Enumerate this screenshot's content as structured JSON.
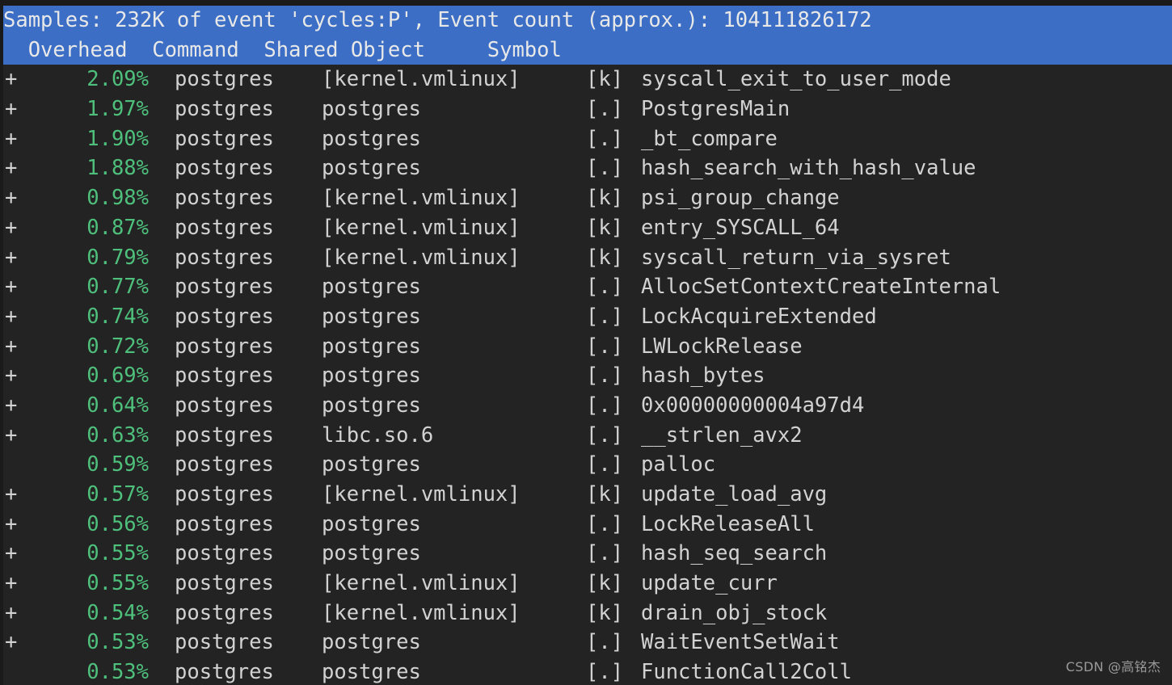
{
  "app": {
    "name": "perf report",
    "colors": {
      "header_bg": "#3b6ec4",
      "header_fg": "#e8e8e8",
      "background": "#232323",
      "overhead_green": "#4ec07c",
      "text_gray": "#d2d2d2"
    }
  },
  "header": {
    "summary": "Samples: 232K of event 'cycles:P', Event count (approx.): 104111826172",
    "samples": "232K",
    "event": "cycles:P",
    "event_count": "104111826172",
    "columns_line": "  Overhead  Command  Shared Object     Symbol",
    "columns": {
      "overhead": "Overhead",
      "command": "Command",
      "shared_object": "Shared Object",
      "symbol": "Symbol"
    }
  },
  "rows": [
    {
      "marker": "+",
      "overhead": "2.09%",
      "command": "postgres",
      "dso": "[kernel.vmlinux]",
      "level": "[k]",
      "symbol": "syscall_exit_to_user_mode"
    },
    {
      "marker": "+",
      "overhead": "1.97%",
      "command": "postgres",
      "dso": "postgres",
      "level": "[.]",
      "symbol": "PostgresMain"
    },
    {
      "marker": "+",
      "overhead": "1.90%",
      "command": "postgres",
      "dso": "postgres",
      "level": "[.]",
      "symbol": "_bt_compare"
    },
    {
      "marker": "+",
      "overhead": "1.88%",
      "command": "postgres",
      "dso": "postgres",
      "level": "[.]",
      "symbol": "hash_search_with_hash_value"
    },
    {
      "marker": "+",
      "overhead": "0.98%",
      "command": "postgres",
      "dso": "[kernel.vmlinux]",
      "level": "[k]",
      "symbol": "psi_group_change"
    },
    {
      "marker": "+",
      "overhead": "0.87%",
      "command": "postgres",
      "dso": "[kernel.vmlinux]",
      "level": "[k]",
      "symbol": "entry_SYSCALL_64"
    },
    {
      "marker": "+",
      "overhead": "0.79%",
      "command": "postgres",
      "dso": "[kernel.vmlinux]",
      "level": "[k]",
      "symbol": "syscall_return_via_sysret"
    },
    {
      "marker": "+",
      "overhead": "0.77%",
      "command": "postgres",
      "dso": "postgres",
      "level": "[.]",
      "symbol": "AllocSetContextCreateInternal"
    },
    {
      "marker": "+",
      "overhead": "0.74%",
      "command": "postgres",
      "dso": "postgres",
      "level": "[.]",
      "symbol": "LockAcquireExtended"
    },
    {
      "marker": "+",
      "overhead": "0.72%",
      "command": "postgres",
      "dso": "postgres",
      "level": "[.]",
      "symbol": "LWLockRelease"
    },
    {
      "marker": "+",
      "overhead": "0.69%",
      "command": "postgres",
      "dso": "postgres",
      "level": "[.]",
      "symbol": "hash_bytes"
    },
    {
      "marker": "+",
      "overhead": "0.64%",
      "command": "postgres",
      "dso": "postgres",
      "level": "[.]",
      "symbol": "0x00000000004a97d4"
    },
    {
      "marker": "+",
      "overhead": "0.63%",
      "command": "postgres",
      "dso": "libc.so.6",
      "level": "[.]",
      "symbol": "__strlen_avx2"
    },
    {
      "marker": "",
      "overhead": "0.59%",
      "command": "postgres",
      "dso": "postgres",
      "level": "[.]",
      "symbol": "palloc"
    },
    {
      "marker": "+",
      "overhead": "0.57%",
      "command": "postgres",
      "dso": "[kernel.vmlinux]",
      "level": "[k]",
      "symbol": "update_load_avg"
    },
    {
      "marker": "+",
      "overhead": "0.56%",
      "command": "postgres",
      "dso": "postgres",
      "level": "[.]",
      "symbol": "LockReleaseAll"
    },
    {
      "marker": "+",
      "overhead": "0.55%",
      "command": "postgres",
      "dso": "postgres",
      "level": "[.]",
      "symbol": "hash_seq_search"
    },
    {
      "marker": "+",
      "overhead": "0.55%",
      "command": "postgres",
      "dso": "[kernel.vmlinux]",
      "level": "[k]",
      "symbol": "update_curr"
    },
    {
      "marker": "+",
      "overhead": "0.54%",
      "command": "postgres",
      "dso": "[kernel.vmlinux]",
      "level": "[k]",
      "symbol": "drain_obj_stock"
    },
    {
      "marker": "+",
      "overhead": "0.53%",
      "command": "postgres",
      "dso": "postgres",
      "level": "[.]",
      "symbol": "WaitEventSetWait"
    },
    {
      "marker": "",
      "overhead": "0.53%",
      "command": "postgres",
      "dso": "postgres",
      "level": "[.]",
      "symbol": "FunctionCall2Coll"
    }
  ],
  "watermark": {
    "text": "CSDN @高铭杰"
  }
}
